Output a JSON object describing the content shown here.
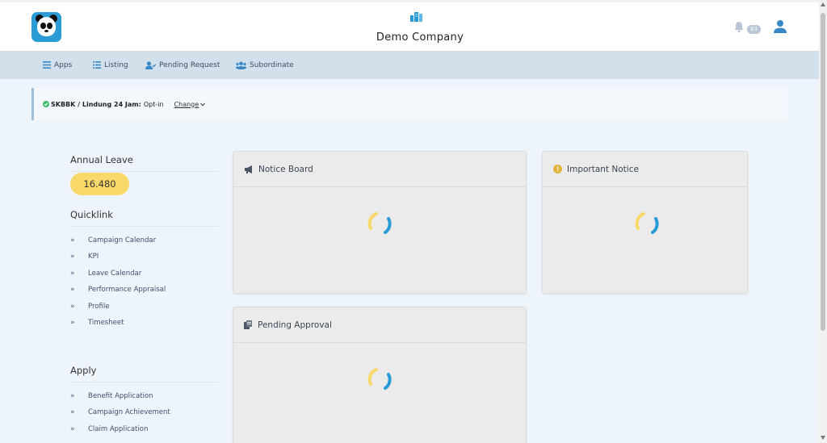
{
  "header": {
    "company_name": "Demo Company",
    "notification_count": "83",
    "logo_icon": "panda-logo-icon",
    "company_icon": "building-icon"
  },
  "nav": {
    "items": [
      {
        "label": "Apps",
        "icon": "menu-icon"
      },
      {
        "label": "Listing",
        "icon": "list-icon"
      },
      {
        "label": "Pending Request",
        "icon": "user-check-icon"
      },
      {
        "label": "Subordinate",
        "icon": "users-icon"
      }
    ]
  },
  "status": {
    "label": "SKBBK / Lindung 24 Jam:",
    "value": "Opt-in",
    "change_label": "Change"
  },
  "sidebar": {
    "annual_leave_title": "Annual Leave",
    "annual_leave_value": "16.480",
    "quicklink_title": "Quicklink",
    "quicklinks": [
      {
        "label": "Campaign Calendar"
      },
      {
        "label": "KPI"
      },
      {
        "label": "Leave Calendar"
      },
      {
        "label": "Performance Appraisal"
      },
      {
        "label": "Profile"
      },
      {
        "label": "Timesheet"
      }
    ],
    "apply_title": "Apply",
    "apply_links": [
      {
        "label": "Benefit Application"
      },
      {
        "label": "Campaign Achievement"
      },
      {
        "label": "Claim Application"
      }
    ]
  },
  "cards": {
    "notice_board": {
      "title": "Notice Board",
      "icon": "megaphone-icon"
    },
    "important_notice": {
      "title": "Important Notice",
      "icon": "info-circle-icon"
    },
    "pending_approval": {
      "title": "Pending Approval",
      "icon": "copy-icon"
    }
  },
  "colors": {
    "navbar": "#d2e0ec",
    "page_bg": "#eef4fb",
    "pill": "#f9d86a",
    "spinner_yellow": "#f9d86a",
    "spinner_blue": "#2a9ad6",
    "status_dot": "#3dbb6a"
  }
}
